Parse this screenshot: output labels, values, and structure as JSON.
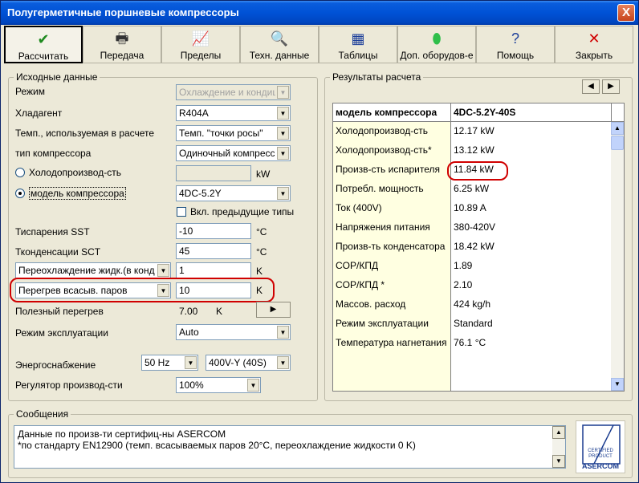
{
  "window": {
    "title": "Полугерметичные поршневые компрессоры",
    "close_glyph": "X"
  },
  "toolbar": [
    {
      "label": "Рассчитать",
      "icon": "check-icon",
      "glyph": "✔",
      "color": "#1f8a1f"
    },
    {
      "label": "Передача",
      "icon": "printer-icon",
      "glyph": "🖶",
      "color": "#333333"
    },
    {
      "label": "Пределы",
      "icon": "chart-limits-icon",
      "glyph": "📈",
      "color": "#c00000"
    },
    {
      "label": "Техн. данные",
      "icon": "magnifier-icon",
      "glyph": "🔍",
      "color": "#333333"
    },
    {
      "label": "Таблицы",
      "icon": "table-icon",
      "glyph": "▦",
      "color": "#1d3f9a"
    },
    {
      "label": "Доп. оборудов-е",
      "icon": "receiver-icon",
      "glyph": "⬮",
      "color": "#2fbf4a"
    },
    {
      "label": "Помощь",
      "icon": "help-icon",
      "glyph": "?",
      "color": "#1d3f9a"
    },
    {
      "label": "Закрыть",
      "icon": "close-x-icon",
      "glyph": "✕",
      "color": "#d00000"
    }
  ],
  "input": {
    "legend": "Исходные данные",
    "mode_label": "Режим",
    "mode_value": "Охлаждение и кондиц",
    "refrigerant_label": "Хладагент",
    "refrigerant_value": "R404A",
    "temp_label": "Темп., используемая в расчете",
    "temp_value": "Темп. \"точки росы\"",
    "comp_type_label": "тип компрессора",
    "comp_type_value": "Одиночный компресс",
    "capacity_radio_label": "Холодопроизвод-сть",
    "capacity_unit": "kW",
    "model_radio_label": "модель компрессора",
    "model_value": "4DC-5.2Y",
    "prev_types_label": "Вкл. предыдущие типы",
    "sst_label": "Тиспарения SST",
    "sst_value": "-10",
    "sst_unit": "°C",
    "sct_label": "Тконденсации SCT",
    "sct_value": "45",
    "sct_unit": "°C",
    "subcool_label": "Переохлаждение жидк.(в конд",
    "subcool_value": "1",
    "subcool_unit": "K",
    "superheat_label": "Перегрев всасыв. паров",
    "superheat_value": "10",
    "superheat_unit": "K",
    "useful_sh_label": "Полезный перегрев",
    "useful_sh_value": "7.00",
    "useful_sh_unit": "K",
    "op_mode_label": "Режим эксплуатации",
    "op_mode_value": "Auto",
    "power_label": "Энергоснабжение",
    "freq_value": "50 Hz",
    "voltage_value": "400V-Y (40S)",
    "regulator_label": "Регулятор производ-сти",
    "regulator_value": "100%"
  },
  "results": {
    "legend": "Результаты расчета",
    "prev_glyph": "◀",
    "next_glyph": "▶",
    "header_name": "модель компрессора",
    "header_value": "4DC-5.2Y-40S",
    "rows": [
      {
        "name": "Холодопроизвод-сть",
        "value": "12.17 kW"
      },
      {
        "name": "Холодопроизвод-сть*",
        "value": "13.12 kW"
      },
      {
        "name": "Произв-сть испарителя",
        "value": "11.84 kW"
      },
      {
        "name": "Потребл. мощность",
        "value": "6.25 kW"
      },
      {
        "name": "Ток (400V)",
        "value": "10.89 A"
      },
      {
        "name": "Напряжения питания",
        "value": "380-420V"
      },
      {
        "name": "Произв-ть конденсатора",
        "value": "18.42 kW"
      },
      {
        "name": "COP/КПД",
        "value": "1.89"
      },
      {
        "name": "COP/КПД *",
        "value": "2.10"
      },
      {
        "name": "Массов. расход",
        "value": "424 kg/h"
      },
      {
        "name": "Режим эксплуатации",
        "value": "Standard"
      },
      {
        "name": "Температура нагнетания",
        "value": "76.1 °C"
      }
    ]
  },
  "messages": {
    "legend": "Сообщения",
    "line1": "Данные по произв-ти сертифиц-ны ASERCOM",
    "line2": "*по стандарту EN12900 (темп.  всасываемых паров 20°C, переохлаждение жидкости 0 K)"
  },
  "logo": {
    "line1": "CERTIFIED",
    "line2": "PRODUCT",
    "brand": "ASERCOM"
  },
  "colors": {
    "title_bar": "#0052d6",
    "highlight_ring": "#d00000",
    "name_column": "#ffffe1",
    "logo_blue": "#1a3c8f"
  }
}
